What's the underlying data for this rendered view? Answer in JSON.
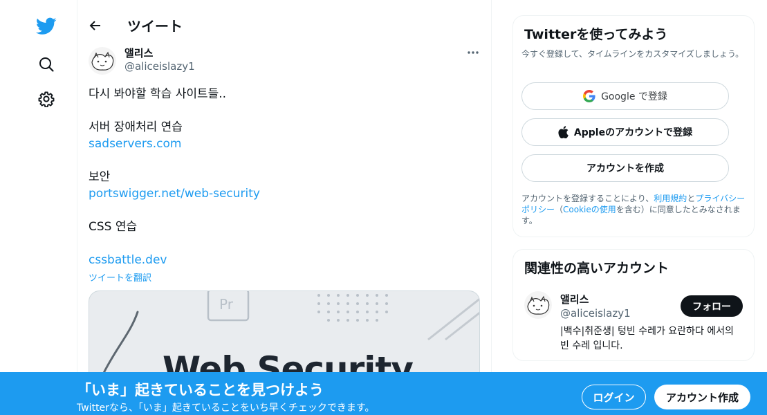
{
  "nav": {
    "icons": [
      "twitter-bird-logo",
      "search-icon",
      "settings-gear-icon"
    ]
  },
  "header": {
    "title": "ツイート"
  },
  "tweet": {
    "author_name": "앨리스",
    "author_handle": "@aliceislazy1",
    "lines": {
      "l1": "다시 봐야할 학습 사이트들..",
      "l2": "서버 장애처리 연습",
      "l3": "sadservers.com",
      "l4": "보안",
      "l5": "portswigger.net/web-security",
      "l6": "CSS 연습",
      "l7": "cssbattle.dev"
    },
    "translate_label": "ツイートを翻訳",
    "card_title": "Web Security"
  },
  "signup_box": {
    "title": "Twitterを使ってみよう",
    "subtitle": "今すぐ登録して、タイムラインをカスタマイズしましょう。",
    "google_label": "Google で登録",
    "apple_label": "Appleのアカウントで登録",
    "create_label": "アカウントを作成",
    "legal": {
      "prefix": "アカウントを登録することにより、",
      "terms": "利用規約",
      "and": "と",
      "privacy": "プライバシーポリシー",
      "open_paren": "（",
      "cookie": "Cookieの使用",
      "suffix": "を含む）に同意したとみなされます。"
    }
  },
  "related": {
    "title": "関連性の高いアカウント",
    "name": "앨리스",
    "handle": "@aliceislazy1",
    "bio": "|백수|취준생| 텅빈 수레가 요란하다 에서의 빈 수레 입니다.",
    "follow_label": "フォロー"
  },
  "banner": {
    "title": "「いま」起きていることを見つけよう",
    "subtitle": "Twitterなら、「いま」起きていることをいち早くチェックできます。",
    "login_label": "ログイン",
    "signup_label": "アカウント作成"
  },
  "colors": {
    "accent": "#1d9bf0",
    "text": "#0f1419",
    "muted": "#536471",
    "border": "#eff3f4"
  }
}
